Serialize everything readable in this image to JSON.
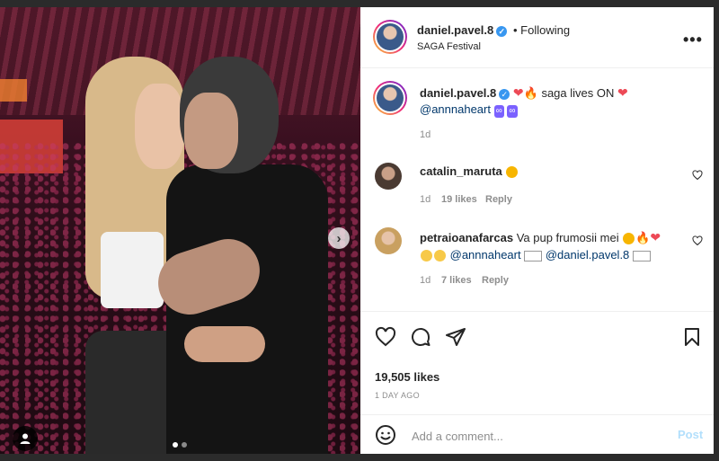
{
  "post": {
    "author": "daniel.pavel.8",
    "follow_status": "Following",
    "location": "SAGA Festival",
    "caption_text": "saga lives ON",
    "caption_mention": "@annnaheart",
    "caption_age": "1d",
    "likes": "19,505 likes",
    "posted": "1 DAY AGO",
    "carousel": {
      "count": 2,
      "active": 0
    }
  },
  "comments": [
    {
      "user": "catalin_maruta",
      "age": "1d",
      "likes": "19 likes",
      "reply": "Reply"
    },
    {
      "user": "petraioanafarcas",
      "text": "Va pup frumosii mei",
      "mention1": "@annnaheart",
      "mention2": "@daniel.pavel.8",
      "age": "1d",
      "likes": "7 likes",
      "reply": "Reply"
    }
  ],
  "composer": {
    "placeholder": "Add a comment...",
    "post_label": "Post"
  },
  "icons": {
    "like": "heart-outline-icon",
    "comment": "comment-icon",
    "share": "share-icon",
    "save": "bookmark-icon",
    "emoji": "smiley-icon",
    "more": "more-dots-icon",
    "verified": "verified-badge-icon",
    "next": "chevron-right-icon",
    "tag": "user-tag-icon"
  },
  "colors": {
    "verified": "#3897f0",
    "post_disabled": "#b2dffc",
    "story_ring": "#ee2a7b",
    "heart_emoji": "#ed4956"
  }
}
